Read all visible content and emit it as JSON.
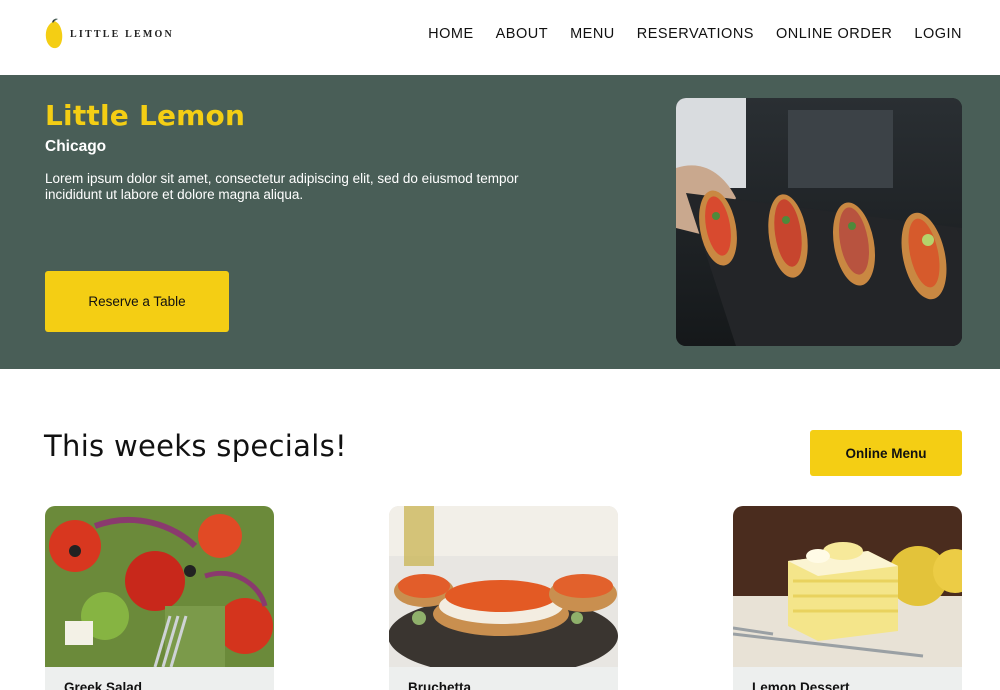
{
  "header": {
    "logo_text": "LITTLE LEMON",
    "nav": [
      "HOME",
      "ABOUT",
      "MENU",
      "RESERVATIONS",
      "ONLINE ORDER",
      "LOGIN"
    ]
  },
  "hero": {
    "title": "Little Lemon",
    "subtitle": "Chicago",
    "description": "Lorem ipsum dolor sit amet, consectetur adipiscing elit, sed do eiusmod tempor incididunt ut labore et dolore magna aliqua.",
    "reserve_label": "Reserve a Table"
  },
  "specials": {
    "title": "This weeks specials!",
    "online_menu_label": "Online Menu",
    "cards": [
      {
        "name": "Greek Salad"
      },
      {
        "name": "Bruchetta"
      },
      {
        "name": "Lemon Dessert"
      }
    ]
  },
  "colors": {
    "brand_green": "#495e57",
    "brand_yellow": "#f4ce14",
    "card_bg": "#edefee"
  }
}
